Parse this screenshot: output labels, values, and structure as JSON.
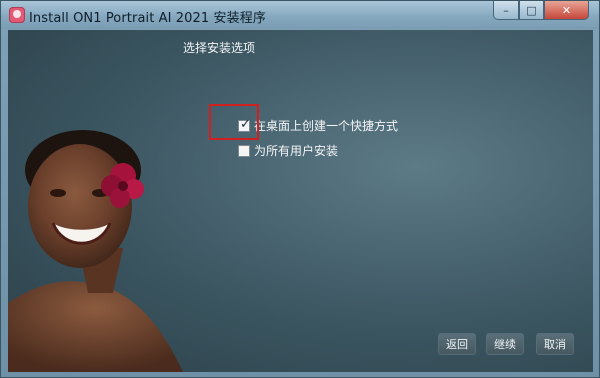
{
  "window": {
    "title": "Install ON1 Portrait AI 2021 安装程序",
    "controls": {
      "minimize": "–",
      "maximize": "□",
      "close": "✕"
    }
  },
  "page": {
    "heading": "选择安装选项",
    "options": [
      {
        "label": "在桌面上创建一个快捷方式",
        "checked": true
      },
      {
        "label": "为所有用户安装",
        "checked": false
      }
    ]
  },
  "buttons": {
    "back": "返回",
    "next": "继续",
    "cancel": "取消"
  },
  "colors": {
    "accent_highlight": "#d02020",
    "content_bg": "#3b5661"
  },
  "icons": {
    "app": "app-icon",
    "flower": "flower"
  }
}
